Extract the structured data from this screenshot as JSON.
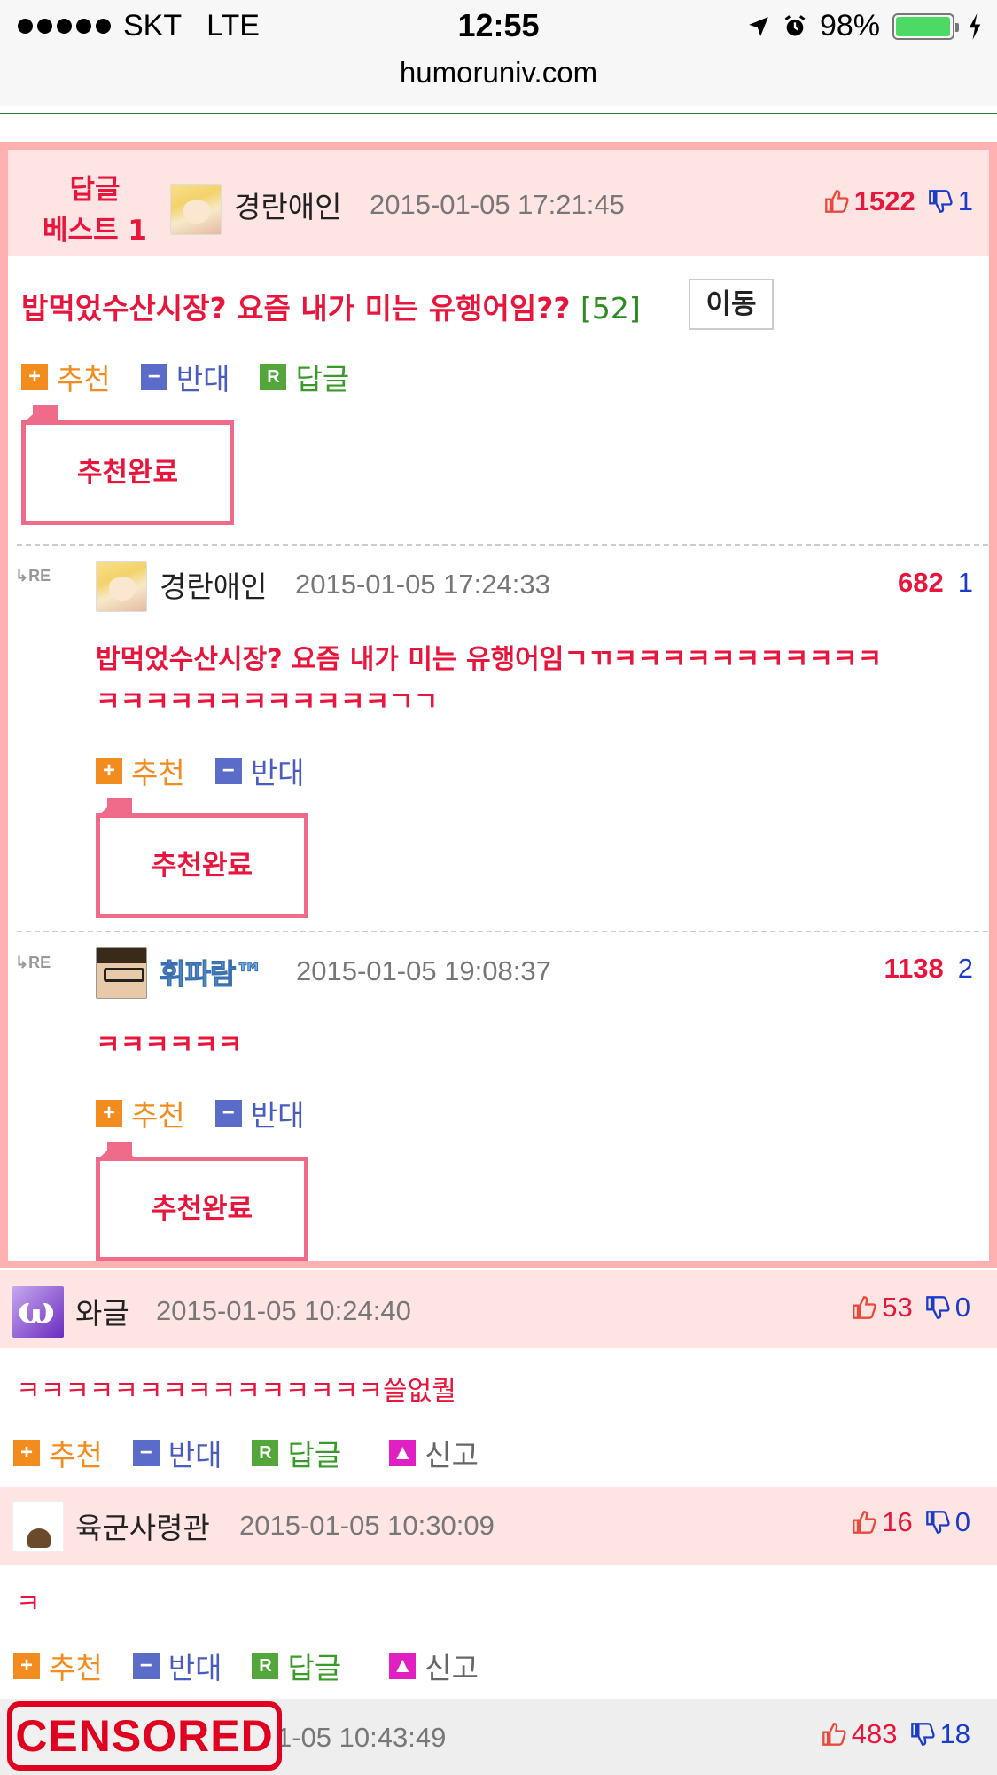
{
  "status_bar": {
    "carrier": "SKT",
    "network": "LTE",
    "time": "12:55",
    "battery": "98%",
    "battery_level": 0.98,
    "icons": [
      "signal-dots-icon",
      "location-arrow-icon",
      "alarm-clock-icon",
      "battery-icon",
      "charging-bolt-icon"
    ]
  },
  "browser": {
    "url": "humoruniv.com"
  },
  "colors": {
    "accent_red": "#e8163c",
    "best_border": "#ffb0b0",
    "header_bg": "#ffe4e4",
    "link_blue": "#1a3cc8"
  },
  "best": {
    "label_line1": "답글",
    "label_line2": "베스트 1",
    "nick": "경란애인",
    "timestamp": "2015-01-05 17:21:45",
    "up": "1522",
    "down": "1",
    "title": "밥먹었수산시장? 요즘 내가 미는 유행어임??",
    "reply_count": "[52]",
    "move_label": "이동",
    "actions": {
      "recommend": "추천",
      "oppose": "반대",
      "reply": "답글"
    },
    "done_label": "추천완료"
  },
  "replies": [
    {
      "re_label": "RE",
      "nick": "경란애인",
      "timestamp": "2015-01-05 17:24:33",
      "up": "682",
      "down": "1",
      "text_line1": "밥먹었수산시장? 요즘 내가 미는 유행어임ㄱㄲㅋㅋㅋㅋㅋㅋㅋㅋㅋㅋㅋ",
      "text_line2": "ㅋㅋㅋㅋㅋㅋㅋㅋㅋㅋㅋㅋㄱㄱ",
      "recommend": "추천",
      "oppose": "반대",
      "done_label": "추천완료"
    },
    {
      "re_label": "RE",
      "nick": "휘파람™",
      "timestamp": "2015-01-05 19:08:37",
      "up": "1138",
      "down": "2",
      "text_line1": "ㅋㅋㅋㅋㅋㅋ",
      "recommend": "추천",
      "oppose": "반대",
      "done_label": "추천완료"
    }
  ],
  "comments": [
    {
      "nick": "와글",
      "timestamp": "2015-01-05 10:24:40",
      "up": "53",
      "down": "0",
      "text": "ㅋㅋㅋㅋㅋㅋㅋㅋㅋㅋㅋㅋㅋㅋㅋ쓸없퀄",
      "recommend": "추천",
      "oppose": "반대",
      "reply": "답글",
      "report": "신고"
    },
    {
      "nick": "육군사령관",
      "timestamp": "2015-01-05 10:30:09",
      "up": "16",
      "down": "0",
      "text": "ㅋ",
      "recommend": "추천",
      "oppose": "반대",
      "reply": "답글",
      "report": "신고"
    }
  ],
  "last": {
    "censored_label": "CENSORED",
    "timestamp_partial": "1-05 10:43:49",
    "up": "483",
    "down": "18"
  }
}
